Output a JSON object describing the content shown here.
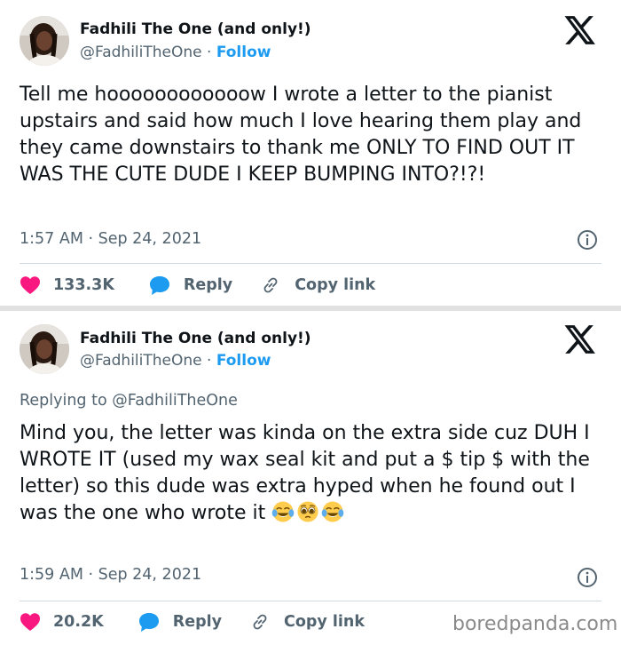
{
  "tweets": [
    {
      "author_name": "Fadhili The One (and only!)",
      "handle": "@FadhiliTheOne",
      "separator": " · ",
      "follow_label": "Follow",
      "text": "Tell me hoooooooooooow I wrote a letter to the pianist upstairs and said how much I love hearing them play and they came downstairs to thank me ONLY TO FIND OUT IT WAS THE CUTE DUDE I KEEP BUMPING INTO?!?!",
      "timestamp": "1:57 AM · Sep 24, 2021",
      "likes": "133.3K",
      "reply_label": "Reply",
      "copy_link_label": "Copy link"
    },
    {
      "author_name": "Fadhili The One (and only!)",
      "handle": "@FadhiliTheOne",
      "separator": " · ",
      "follow_label": "Follow",
      "replying_prefix": "Replying to ",
      "replying_to": "@FadhiliTheOne",
      "text": "Mind you, the letter was kinda on the extra side cuz DUH I WROTE IT (used my wax seal kit and put a $ tip $ with the letter) so this dude was extra hyped when he found out I was the one who wrote it ",
      "emojis": [
        "face-with-tears-of-joy",
        "pleading-face",
        "face-with-tears-of-joy"
      ],
      "timestamp": "1:59 AM · Sep 24, 2021",
      "likes": "20.2K",
      "reply_label": "Reply",
      "copy_link_label": "Copy link"
    }
  ],
  "watermark": "boredpanda.com",
  "colors": {
    "accent": "#1d9bf0",
    "like": "#f91880",
    "text": "#0f1419",
    "muted": "#536471"
  }
}
